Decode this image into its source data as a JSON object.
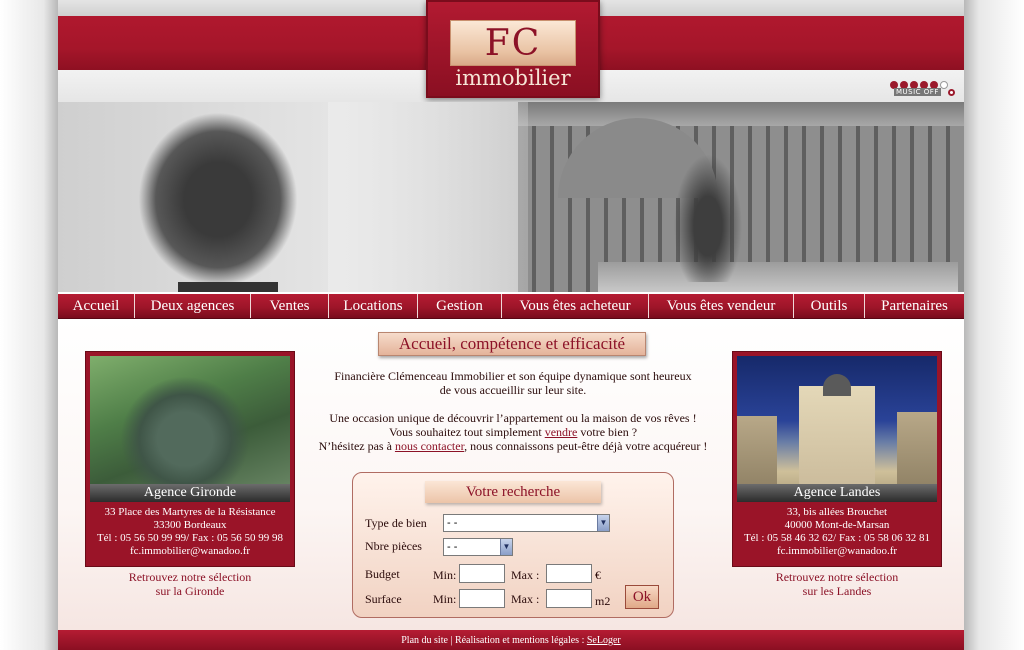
{
  "brand": {
    "logo_main": "FC",
    "logo_sub": "immobilier"
  },
  "music": {
    "label": "MUSIC OFF"
  },
  "nav": [
    {
      "label": "Accueil"
    },
    {
      "label": "Deux agences"
    },
    {
      "label": "Ventes"
    },
    {
      "label": "Locations"
    },
    {
      "label": "Gestion"
    },
    {
      "label": "Vous êtes acheteur"
    },
    {
      "label": "Vous êtes vendeur"
    },
    {
      "label": "Outils"
    },
    {
      "label": "Partenaires"
    }
  ],
  "tagline": "Accueil, compétence et efficacité",
  "intro": {
    "line1": "Financière Clémenceau Immobilier et son équipe dynamique sont heureux",
    "line2": "de vous accueillir sur leur site.",
    "line3": "Une occasion unique de découvrir l’appartement ou la maison de vos rêves !",
    "line4_pre": "Vous souhaitez tout simplement ",
    "line4_link": "vendre",
    "line4_post": " votre bien ?",
    "line5_pre": "N’hésitez pas à ",
    "line5_link": "nous contacter",
    "line5_post": ", nous connaissons peut-être déjà votre acquéreur !"
  },
  "agency_left": {
    "name": "Agence Gironde",
    "address": "33 Place des Martyres de la Résistance",
    "city": "33300 Bordeaux",
    "phone": "Tél : 05 56 50 99 99/ Fax : 05 56 50 99 98",
    "email": "fc.immobilier@wanadoo.fr",
    "selection_1": "Retrouvez notre sélection",
    "selection_2": "sur la Gironde"
  },
  "agency_right": {
    "name": "Agence Landes",
    "address": "33, bis allées Brouchet",
    "city": "40000 Mont-de-Marsan",
    "phone": "Tél : 05 58 46 32 62/ Fax : 05 58 06 32 81",
    "email": "fc.immobilier@wanadoo.fr",
    "selection_1": "Retrouvez notre sélection",
    "selection_2": "sur les Landes"
  },
  "search": {
    "title": "Votre recherche",
    "type_label": "Type de bien",
    "type_value": "- -",
    "rooms_label": "Nbre pièces",
    "rooms_value": "- -",
    "budget_label": "Budget",
    "surface_label": "Surface",
    "min_label": "Min:",
    "max_label": "Max :",
    "budget_unit": "€",
    "surface_unit": "m2",
    "ok_label": "Ok"
  },
  "footer": {
    "sitemap": "Plan du site",
    "sep": " | ",
    "credits": "Réalisation et mentions légales : ",
    "partner": "SeLoger"
  },
  "colors": {
    "brand_red": "#9e1529",
    "accent_text": "#8c1227"
  },
  "icons": [
    "music-dot-icon",
    "select-arrow-icon"
  ]
}
